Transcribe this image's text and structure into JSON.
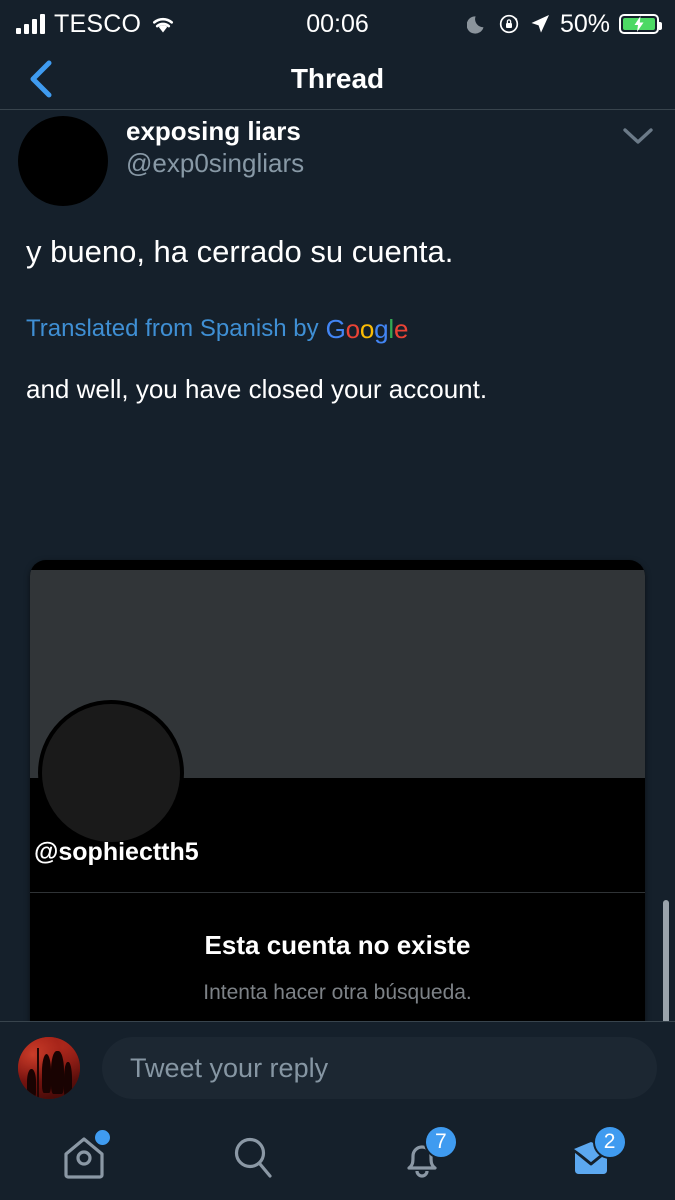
{
  "status_bar": {
    "carrier": "TESCO",
    "time": "00:06",
    "battery_percent": "50%",
    "icons": [
      "signal-bars-icon",
      "wifi-icon",
      "moon-icon",
      "rotation-lock-icon",
      "location-arrow-icon",
      "battery-charging-icon"
    ],
    "battery_color": "#4cd964"
  },
  "navbar": {
    "title": "Thread",
    "back_label": "",
    "accent": "#3f9bf0"
  },
  "tweet": {
    "display_name": "exposing liars",
    "handle": "@exp0singliars",
    "body": "y bueno, ha cerrado su cuenta.",
    "translation_notice": "Translated from Spanish by",
    "translation_provider": "Google",
    "google_letters": [
      {
        "char": "G",
        "color": "#4285F4"
      },
      {
        "char": "o",
        "color": "#EA4335"
      },
      {
        "char": "o",
        "color": "#FBBC05"
      },
      {
        "char": "g",
        "color": "#4285F4"
      },
      {
        "char": "l",
        "color": "#34A853"
      },
      {
        "char": "e",
        "color": "#EA4335"
      }
    ],
    "translated_body": "and well, you have closed your account.",
    "link_color": "#3f8fd4"
  },
  "media_card": {
    "handle": "@sophiectth5",
    "empty_title": "Esta cuenta no existe",
    "empty_subtitle": "Intenta hacer otra búsqueda.",
    "banner_color": "#313538",
    "background_color": "#000000"
  },
  "reply": {
    "placeholder": "Tweet your reply",
    "avatar_name": "user-avatar"
  },
  "tabbar": {
    "items": [
      {
        "name": "home",
        "icon": "home-icon",
        "badge": "",
        "dot": true,
        "active": false
      },
      {
        "name": "search",
        "icon": "search-icon",
        "badge": "",
        "dot": false,
        "active": false
      },
      {
        "name": "notifications",
        "icon": "bell-icon",
        "badge": "7",
        "dot": false,
        "active": false
      },
      {
        "name": "messages",
        "icon": "envelope-icon",
        "badge": "2",
        "dot": false,
        "active": true
      }
    ]
  }
}
